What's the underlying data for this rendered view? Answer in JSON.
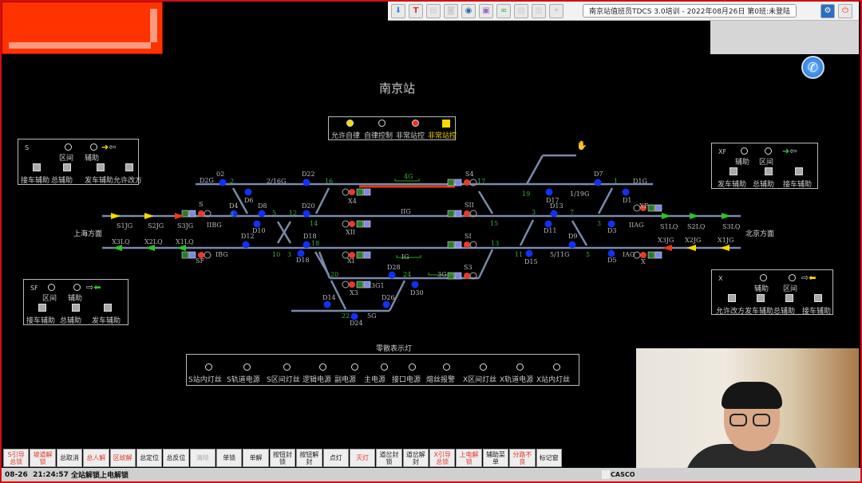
{
  "toolbar": {
    "title": "南京站值班员TDCS 3.0培训 - 2022年08月26日 第0班:未登陆",
    "icons": [
      "download-icon",
      "tdcs-icon",
      "note-icon",
      "camera-icon",
      "screenshot-icon",
      "train-icon",
      "link-icon",
      "image-icon",
      "doc-icon",
      "settings-small-icon"
    ]
  },
  "station_name": "南京站",
  "legend": [
    {
      "label": "允许自律",
      "color": "#f5d800"
    },
    {
      "label": "自律控制",
      "color": "#000000"
    },
    {
      "label": "非常站控",
      "color": "#e8301a"
    },
    {
      "label": "非常站控",
      "color": "#f5d800"
    }
  ],
  "panels": {
    "S": {
      "name": "S",
      "lamps": [
        "区间",
        "辅助"
      ],
      "buttons": [
        "接车辅助",
        "总辅助",
        "发车辅助",
        "允许改方"
      ]
    },
    "XF": {
      "name": "XF",
      "lamps": [
        "辅助",
        "区间"
      ],
      "buttons": [
        "发车辅助",
        "总辅助",
        "接车辅助"
      ]
    },
    "SF": {
      "name": "SF",
      "lamps": [
        "区间",
        "辅助"
      ],
      "buttons": [
        "接车辅助",
        "总辅助",
        "发车辅助"
      ]
    },
    "X": {
      "name": "X",
      "lamps": [
        "辅助",
        "区间"
      ],
      "buttons": [
        "允许改方",
        "发车辅助",
        "总辅助",
        "接车辅助"
      ]
    }
  },
  "directions": {
    "left": "上海方面",
    "right": "北京方面"
  },
  "track_labels": [
    "D2G",
    "02",
    "2",
    "2/16G",
    "D22",
    "16",
    "D6",
    "X4",
    "4G",
    "S4",
    "17",
    "19",
    "D17",
    "D7",
    "1",
    "D1G",
    "D1",
    "1/19G",
    "S1JG",
    "S2JG",
    "S3JG",
    "S",
    "IIBG",
    "D4",
    "D8",
    "5",
    "12",
    "D20",
    "14",
    "4",
    "D10",
    "IIG",
    "XII",
    "SII",
    "15",
    "3",
    "D13",
    "7",
    "D11",
    "3",
    "D3",
    "IIAG",
    "XF",
    "S1LQ",
    "S2LQ",
    "S3LQ",
    "X3LQ",
    "X2LQ",
    "X1LQ",
    "SF",
    "IBG",
    "D12",
    "10",
    "3",
    "D18",
    "D18",
    "18",
    "XI",
    "IG",
    "SI",
    "13",
    "11",
    "D15",
    "5/11G",
    "D9",
    "5",
    "D5",
    "IAG",
    "X",
    "X3JG",
    "X2JG",
    "X1JG",
    "D28",
    "20",
    "24",
    "3G",
    "S3",
    "D30",
    "X3",
    "3G1",
    "D14",
    "D26",
    "22",
    "D24",
    "5G"
  ],
  "fault_title": "零散表示灯",
  "fault_lamps": [
    "S站内灯丝",
    "S轨道电源",
    "S区间灯丝",
    "逻辑电源",
    "副电源",
    "主电源",
    "接口电源",
    "熔丝报警",
    "X区间灯丝",
    "X轨道电源",
    "X站内灯丝"
  ],
  "buttons": [
    {
      "label": "S引导总锁",
      "style": "red"
    },
    {
      "label": "坡道解锁",
      "style": "red"
    },
    {
      "label": "总取消",
      "style": "normal"
    },
    {
      "label": "总人解",
      "style": "red"
    },
    {
      "label": "区故解",
      "style": "red"
    },
    {
      "label": "总定位",
      "style": "normal"
    },
    {
      "label": "总反位",
      "style": "normal"
    },
    {
      "label": "清除",
      "style": "gray"
    },
    {
      "label": "单锁",
      "style": "normal"
    },
    {
      "label": "单解",
      "style": "normal"
    },
    {
      "label": "按钮封锁",
      "style": "normal"
    },
    {
      "label": "按钮解封",
      "style": "normal"
    },
    {
      "label": "点灯",
      "style": "normal"
    },
    {
      "label": "灭灯",
      "style": "red"
    },
    {
      "label": "道岔封锁",
      "style": "normal"
    },
    {
      "label": "道岔解封",
      "style": "normal"
    },
    {
      "label": "X引导总锁",
      "style": "red"
    },
    {
      "label": "上电解锁",
      "style": "red"
    },
    {
      "label": "辅助菜单",
      "style": "normal"
    },
    {
      "label": "分路不良",
      "style": "red"
    },
    {
      "label": "标记窗",
      "style": "normal"
    }
  ],
  "status": {
    "date": "08-26",
    "time": "21:24:57",
    "message": "全站解锁上电解锁",
    "brand": "CASCO"
  }
}
